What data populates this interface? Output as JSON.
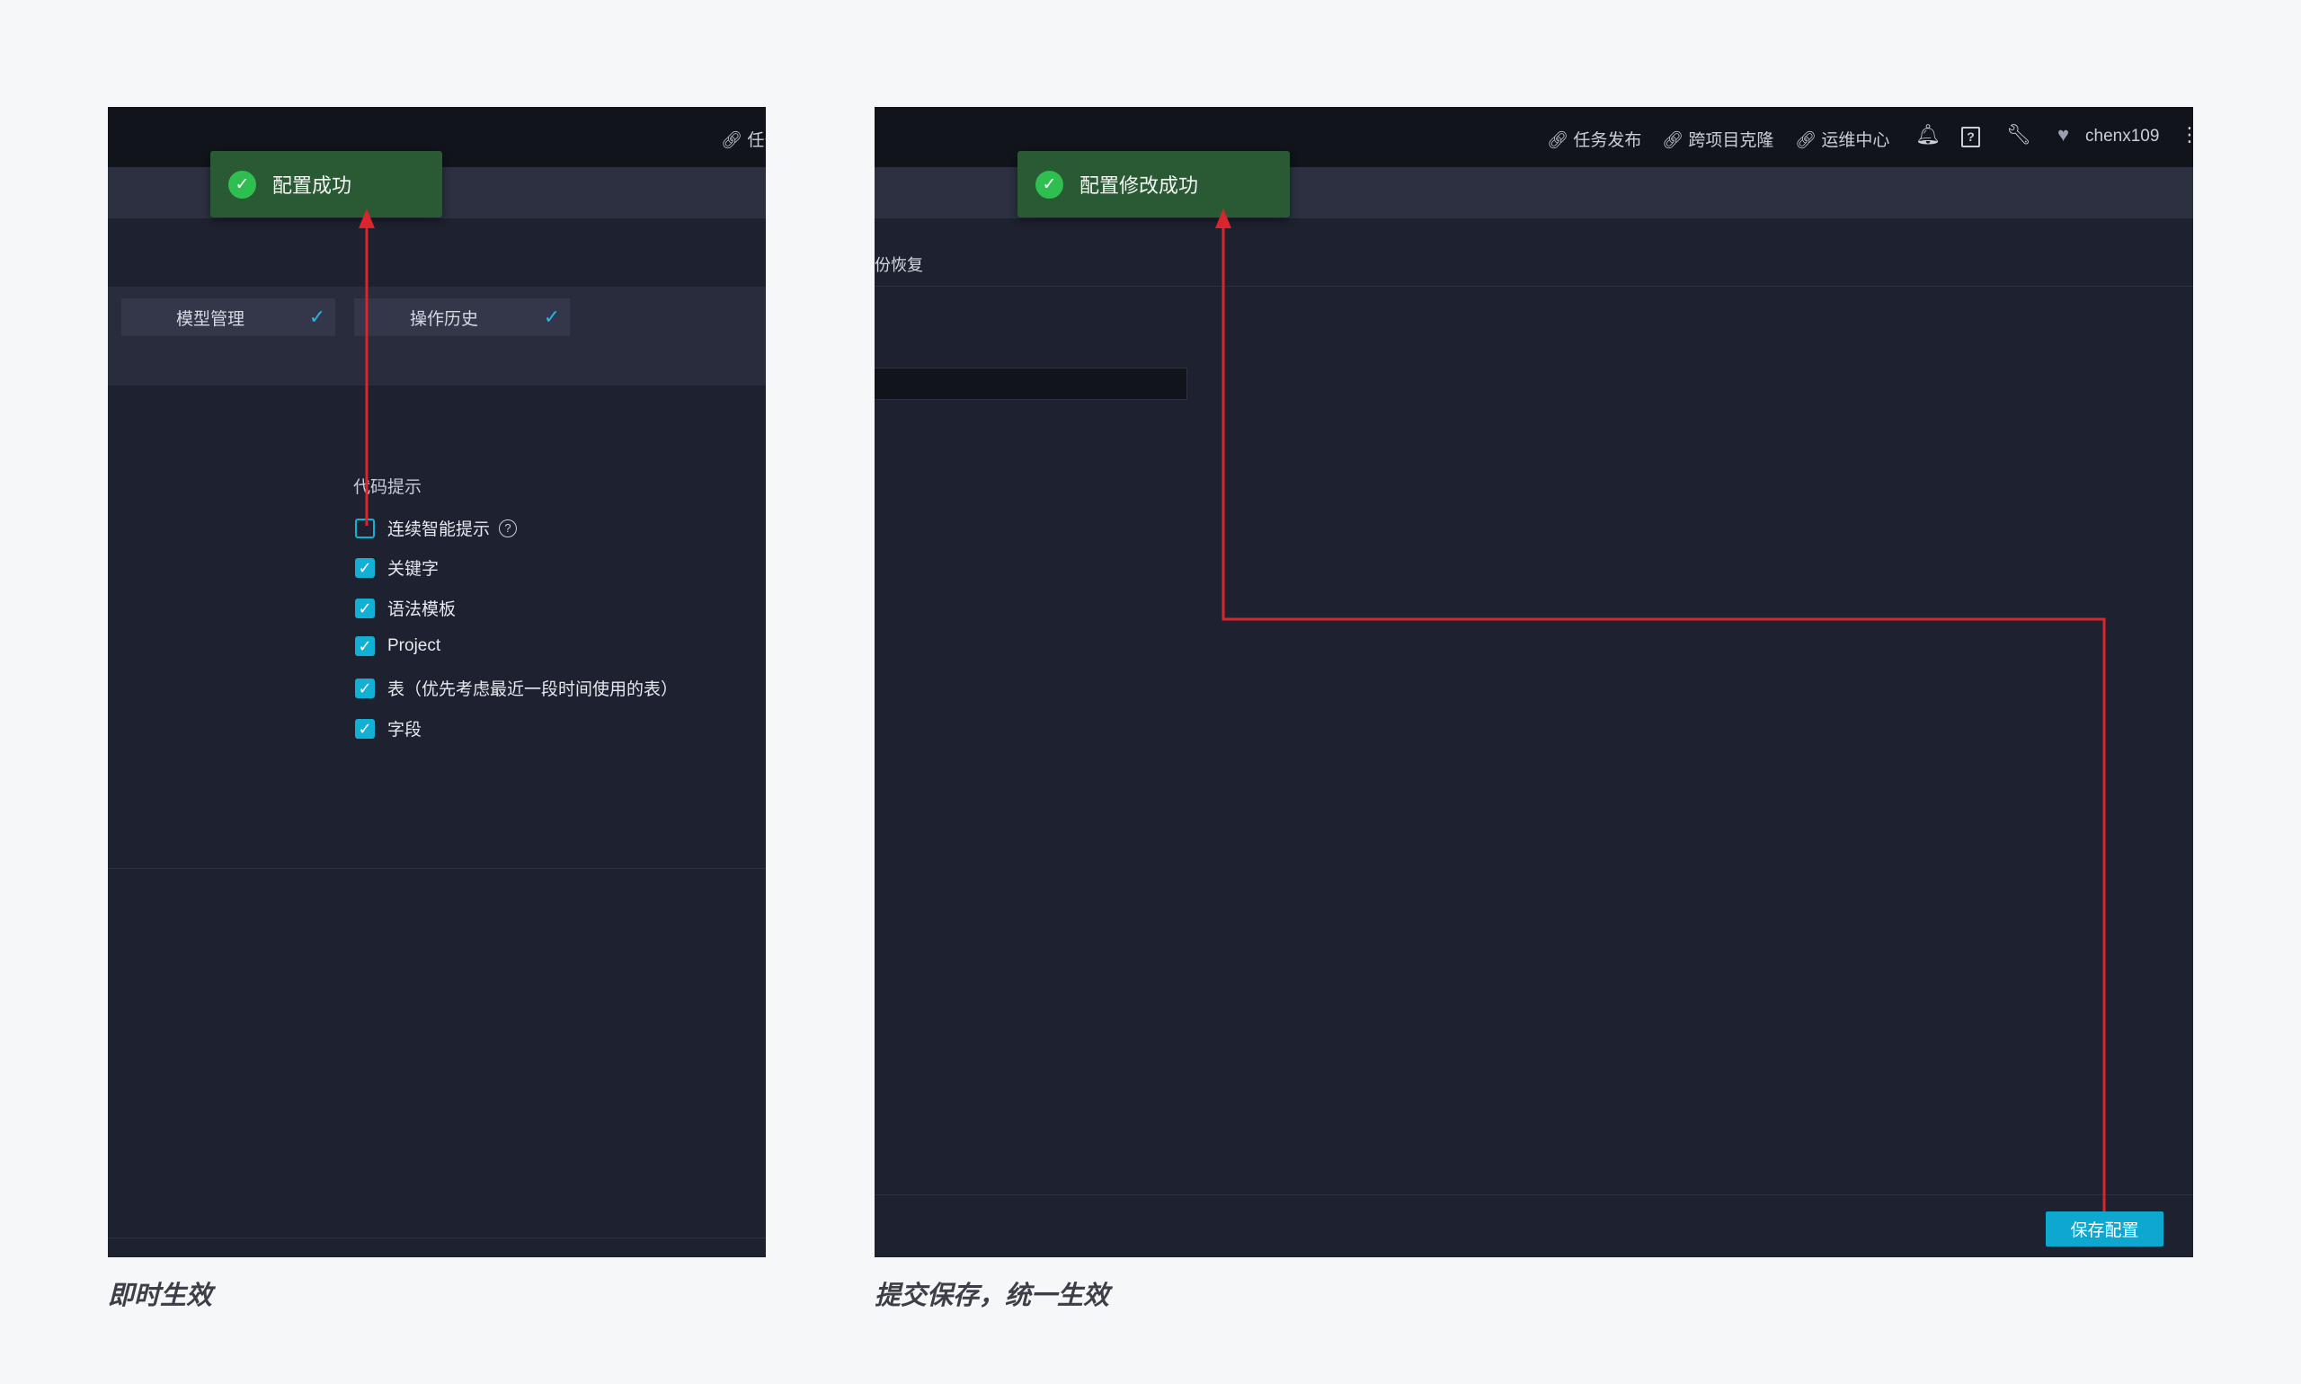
{
  "left_panel": {
    "top_link_partial": "任务",
    "toast": "配置成功",
    "tabs": [
      {
        "label": "模型管理"
      },
      {
        "label": "操作历史"
      }
    ],
    "section_title": "代码提示",
    "checkboxes": [
      {
        "label": "连续智能提示",
        "checked": false,
        "has_help": true
      },
      {
        "label": "关键字",
        "checked": true
      },
      {
        "label": "语法模板",
        "checked": true
      },
      {
        "label": "Project",
        "checked": true
      },
      {
        "label": "表（优先考虑最近一段时间使用的表）",
        "checked": true
      },
      {
        "label": "字段",
        "checked": true
      }
    ],
    "caption": "即时生效"
  },
  "right_panel": {
    "nav_links": [
      "任务发布",
      "跨项目克隆",
      "运维中心"
    ],
    "username": "chenx109",
    "toast": "配置修改成功",
    "breadcrumb_partial": "份恢复",
    "save_button": "保存配置",
    "caption": "提交保存，统一生效"
  },
  "colors": {
    "panel_bg": "#1e2130",
    "toast_bg": "#2a5a33",
    "accent": "#13b0d6",
    "annotation_arrow": "#d9252b"
  },
  "icons": [
    "check-circle-icon",
    "link-icon",
    "bell-icon",
    "help-box-icon",
    "wrench-icon",
    "avatar-icon",
    "more-vertical-icon",
    "question-circle-icon",
    "checkmark-icon"
  ]
}
